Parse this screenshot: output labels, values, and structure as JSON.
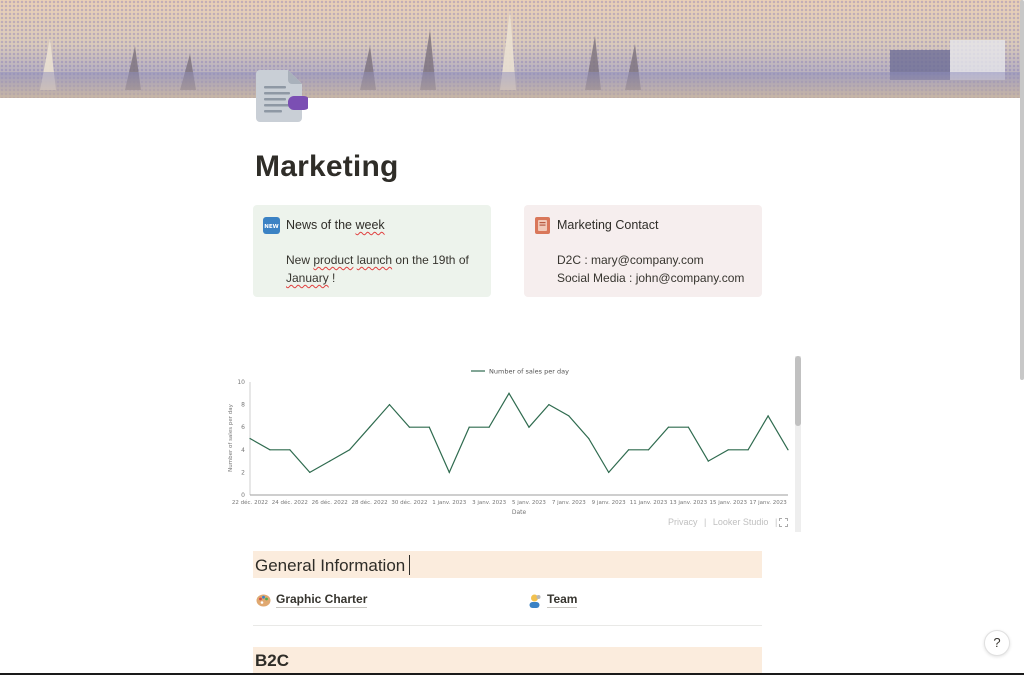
{
  "page": {
    "title": "Marketing"
  },
  "callouts": {
    "news": {
      "icon": "new-badge-icon",
      "title_plain": "News of the ",
      "title_underlined": "week",
      "body_1": "New ",
      "body_product": "product",
      "body_2": " ",
      "body_launch": "launch",
      "body_3": " on the 19th of ",
      "body_january": "January",
      "body_4": " !"
    },
    "contact": {
      "icon": "notebook-icon",
      "title": "Marketing Contact",
      "line1": "D2C : mary@company.com",
      "line2": "Social Media : john@company.com"
    }
  },
  "embed": {
    "footer_privacy": "Privacy",
    "footer_sep": "|",
    "footer_brand": "Looker Studio",
    "footer_sep2": "|"
  },
  "chart_data": {
    "type": "line",
    "legend": "Number of sales per day",
    "legend_position": "top-center",
    "xlabel": "Date",
    "ylabel": "Number of sales per day",
    "ylim": [
      0,
      10
    ],
    "yticks": [
      "0",
      "2",
      "4",
      "6",
      "8",
      "10"
    ],
    "xticks": [
      "22 déc. 2022",
      "24 déc. 2022",
      "26 déc. 2022",
      "28 déc. 2022",
      "30 déc. 2022",
      "1 janv. 2023",
      "3 janv. 2023",
      "5 janv. 2023",
      "7 janv. 2023",
      "9 janv. 2023",
      "11 janv. 2023",
      "13 janv. 2023",
      "15 janv. 2023",
      "17 janv. 2023"
    ],
    "values": [
      5,
      4,
      4,
      2,
      3,
      4,
      6,
      8,
      6,
      6,
      2,
      6,
      6,
      9,
      6,
      8,
      7,
      5,
      2,
      4,
      4,
      6,
      6,
      3,
      4,
      4,
      7,
      4
    ],
    "line_color": "#2f6b4f",
    "grid": false
  },
  "sections": {
    "general": {
      "title": "General Information"
    },
    "b2c": {
      "title": "B2C"
    }
  },
  "links": [
    {
      "icon": "palette-icon",
      "label": "Graphic Charter"
    },
    {
      "icon": "team-icon",
      "label": "Team"
    }
  ],
  "help": {
    "label": "?"
  },
  "colors": {
    "news_bg": "#edf3ec",
    "contact_bg": "#f6eeee",
    "heading_bg": "#fbecdd"
  }
}
